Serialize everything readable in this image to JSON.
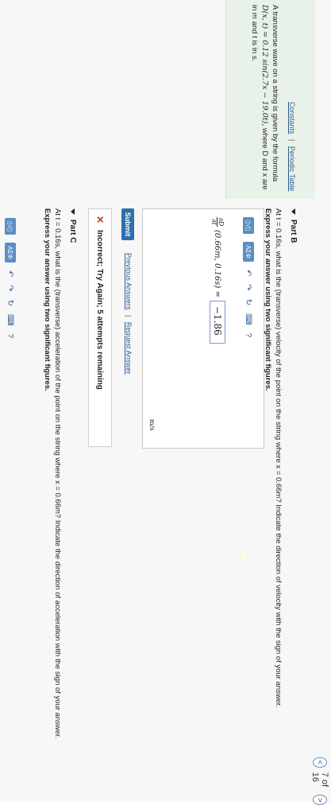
{
  "pager": {
    "prev_glyph": "<",
    "count": "7 of 16",
    "next_glyph": ">"
  },
  "sidebar": {
    "constants_link": "Constants",
    "separator": "|",
    "periodic_link": "Periodic Table",
    "problem_intro": "A transverse wave on a string is given by the formula",
    "formula": "D(x, t) = 0.12 sin(2.7x − 19.0t),",
    "problem_where": "where D and x are in m and t is in s."
  },
  "part_b": {
    "title": "Part B",
    "question": "At t = 0.16s, what is the (transverse) velocity of the point on the string where x = 0.66m? Indicate the direction of velocity with the sign of your answer.",
    "instruction": "Express your answer using two significant figures.",
    "toolbar": [
      "▯√▯",
      "ΑΣΦ",
      "undo-icon",
      "redo-icon",
      "refresh-icon",
      "keyboard-icon",
      "?"
    ],
    "eq_num": "∂D",
    "eq_den": "∂t",
    "eq_args": "(0.66m, 0.16s) =",
    "answer_value": "−1.86",
    "unit": "m/s",
    "submit_label": "Submit",
    "previous_answers": "Previous Answers",
    "link_separator": "|",
    "request_answer": "Request Answer",
    "feedback": "Incorrect; Try Again; 5 attempts remaining"
  },
  "part_c": {
    "title": "Part C",
    "question": "At t = 0.16s, what is the (transverse) acceleration of the point on the string where x = 0.66m? Indicate the direction of acceleration with the sign of your answer.",
    "instruction": "Express your answer using two significant figures.",
    "toolbar": [
      "▯√▯",
      "ΑΣΦ",
      "undo-icon",
      "redo-icon",
      "refresh-icon",
      "keyboard-icon",
      "?"
    ]
  }
}
